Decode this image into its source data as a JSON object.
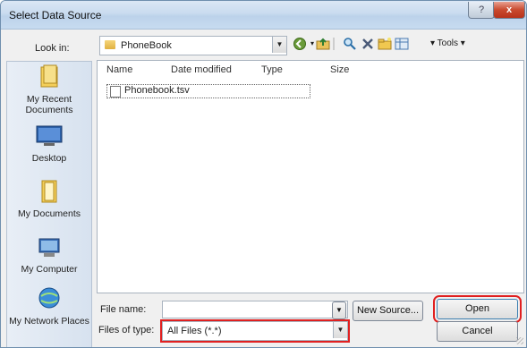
{
  "window": {
    "title": "Select Data Source",
    "help_glyph": "?",
    "close_glyph": "x"
  },
  "lookin": {
    "label": "Look in:",
    "value": "PhoneBook"
  },
  "toolbar": {
    "tools_label": "Tools",
    "tools_arrow": "▾",
    "view_arrow": "▾"
  },
  "places": [
    {
      "label": "My Recent Documents",
      "icon": "recent-documents-icon"
    },
    {
      "label": "Desktop",
      "icon": "desktop-icon"
    },
    {
      "label": "My Documents",
      "icon": "my-documents-icon"
    },
    {
      "label": "My Computer",
      "icon": "my-computer-icon"
    },
    {
      "label": "My Network Places",
      "icon": "network-places-icon"
    }
  ],
  "filelist": {
    "columns": [
      "Name",
      "Date modified",
      "Type",
      "Size"
    ],
    "items": [
      {
        "name": "Phonebook.tsv"
      }
    ]
  },
  "filename": {
    "label": "File name:",
    "value": ""
  },
  "filetype": {
    "label": "Files of type:",
    "value": "All Files (*.*)"
  },
  "buttons": {
    "new_source": "New Source...",
    "open": "Open",
    "cancel": "Cancel"
  },
  "colors": {
    "highlight": "#e02020",
    "title_bar": "#c9dbef"
  }
}
